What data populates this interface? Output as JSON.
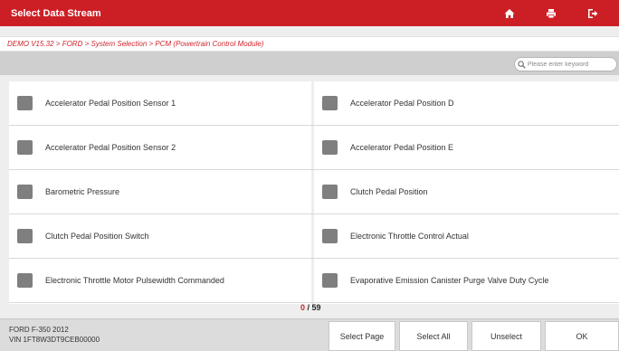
{
  "header": {
    "title": "Select Data Stream",
    "background_color": "#cc1f25",
    "icons": [
      "home-icon",
      "print-icon",
      "exit-icon"
    ]
  },
  "breadcrumb": "DEMO V15.32 > FORD > System Selection > PCM (Powertrain Control Module)",
  "search": {
    "placeholder": "Please enter keyword",
    "value": ""
  },
  "items": [
    {
      "label": "Accelerator Pedal Position Sensor 1",
      "checked": false
    },
    {
      "label": "Accelerator Pedal Position D",
      "checked": false
    },
    {
      "label": "Accelerator Pedal Position Sensor 2",
      "checked": false
    },
    {
      "label": "Accelerator Pedal Position E",
      "checked": false
    },
    {
      "label": "Barometric Pressure",
      "checked": false
    },
    {
      "label": "Clutch Pedal Position",
      "checked": false
    },
    {
      "label": "Clutch Pedal Position Switch",
      "checked": false
    },
    {
      "label": "Electronic Throttle Control Actual",
      "checked": false
    },
    {
      "label": "Electronic Throttle Motor Pulsewidth Commanded",
      "checked": false
    },
    {
      "label": "Evaporative Emission Canister Purge Valve Duty Cycle",
      "checked": false
    }
  ],
  "counter": {
    "selected": "0",
    "total": "/ 59"
  },
  "vehicle": {
    "model": "FORD F-350 2012",
    "vin": "VIN 1FT8W3DT9CEB00000"
  },
  "buttons": {
    "select_page": "Select Page",
    "select_all": "Select All",
    "unselect": "Unselect",
    "ok": "OK"
  },
  "colors": {
    "accent": "#d0262d",
    "checkbox": "#7f7f7f"
  }
}
